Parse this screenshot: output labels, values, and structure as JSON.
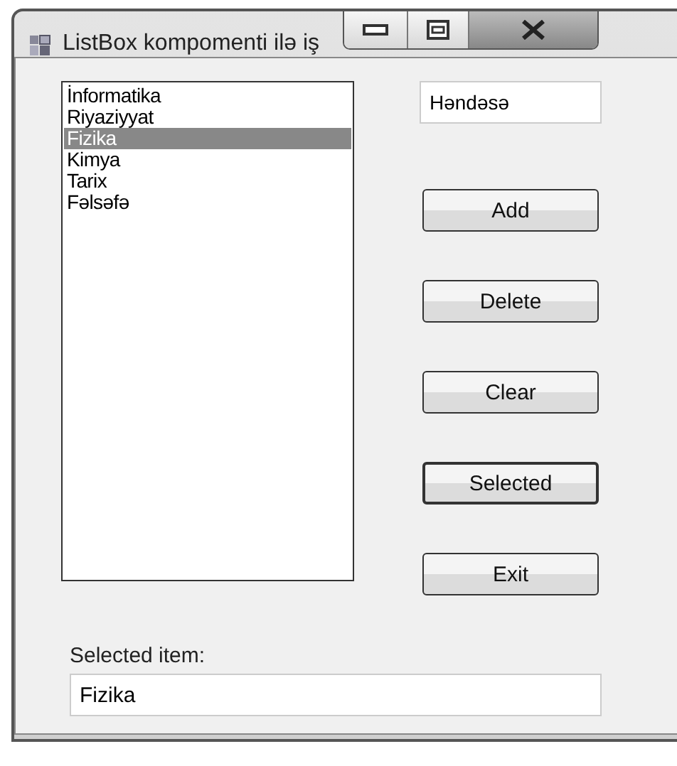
{
  "window": {
    "title": "ListBox kompomenti ilə iş"
  },
  "list": {
    "items": [
      {
        "label": "İnformatika",
        "selected": false
      },
      {
        "label": "Riyaziyyat",
        "selected": false
      },
      {
        "label": "Fizika",
        "selected": true
      },
      {
        "label": "Kimya",
        "selected": false
      },
      {
        "label": "Tarix",
        "selected": false
      },
      {
        "label": "Fəlsəfə",
        "selected": false
      }
    ]
  },
  "input": {
    "value": "Həndəsə"
  },
  "buttons": [
    {
      "label": "Add",
      "default": false
    },
    {
      "label": "Delete",
      "default": false
    },
    {
      "label": "Clear",
      "default": false
    },
    {
      "label": "Selected",
      "default": true
    },
    {
      "label": "Exit",
      "default": false
    }
  ],
  "selected_label": "Selected item:",
  "selected_value": "Fizika"
}
